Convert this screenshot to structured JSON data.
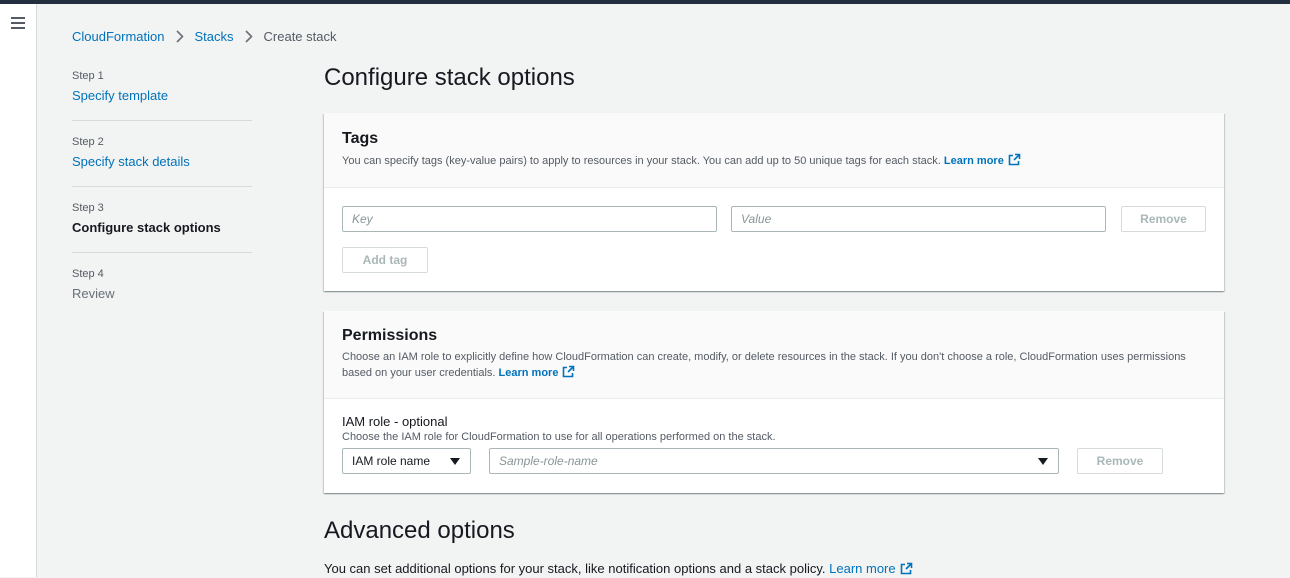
{
  "breadcrumb": {
    "items": [
      "CloudFormation",
      "Stacks"
    ],
    "current": "Create stack"
  },
  "steps": [
    {
      "num": "Step 1",
      "label": "Specify template"
    },
    {
      "num": "Step 2",
      "label": "Specify stack details"
    },
    {
      "num": "Step 3",
      "label": "Configure stack options"
    },
    {
      "num": "Step 4",
      "label": "Review"
    }
  ],
  "page": {
    "title": "Configure stack options"
  },
  "tags": {
    "title": "Tags",
    "description": "You can specify tags (key-value pairs) to apply to resources in your stack. You can add up to 50 unique tags for each stack.",
    "learn_more": "Learn more",
    "key_placeholder": "Key",
    "value_placeholder": "Value",
    "remove_label": "Remove",
    "add_label": "Add tag"
  },
  "permissions": {
    "title": "Permissions",
    "description": "Choose an IAM role to explicitly define how CloudFormation can create, modify, or delete resources in the stack. If you don't choose a role, CloudFormation uses permissions based on your user credentials.",
    "learn_more": "Learn more",
    "iam_label": "IAM role - optional",
    "iam_hint": "Choose the IAM role for CloudFormation to use for all operations performed on the stack.",
    "type_select": "IAM role name",
    "role_placeholder": "Sample-role-name",
    "remove_label": "Remove"
  },
  "advanced": {
    "title": "Advanced options",
    "description": "You can set additional options for your stack, like notification options and a stack policy.",
    "learn_more": "Learn more"
  },
  "colors": {
    "link": "#0073bb",
    "header_bar": "#232f3e",
    "background": "#f2f3f3"
  }
}
